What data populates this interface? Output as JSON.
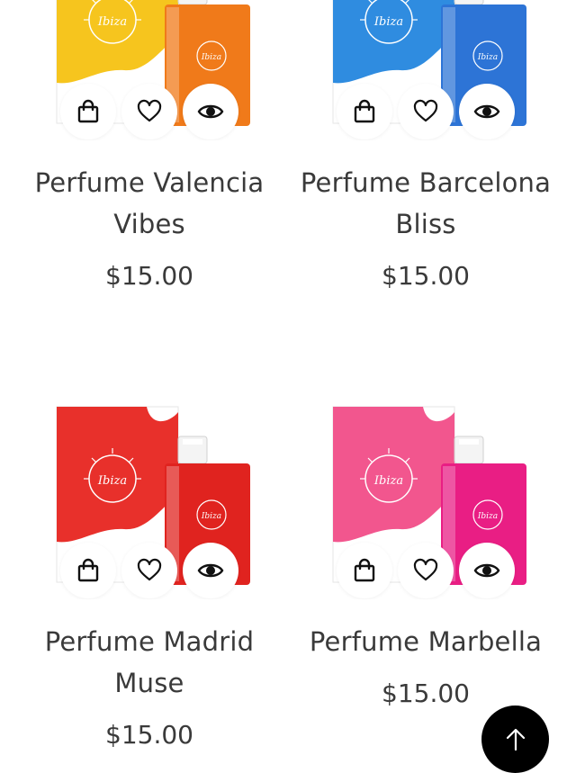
{
  "products": [
    {
      "name": "Perfume Valencia Vibes",
      "price": "$15.00",
      "box_color": "#f6c51e",
      "bottle_color": "#f07a1a",
      "brand_mark": "Ibiza",
      "cart_icon": "shopping-bag-icon",
      "wishlist_icon": "heart-icon",
      "quickview_icon": "eye-icon"
    },
    {
      "name": "Perfume Barcelona Bliss",
      "price": "$15.00",
      "box_color": "#2f8ce0",
      "bottle_color": "#2d74d6",
      "brand_mark": "Ibiza",
      "cart_icon": "shopping-bag-icon",
      "wishlist_icon": "heart-icon",
      "quickview_icon": "eye-icon"
    },
    {
      "name": "Perfume Madrid Muse",
      "price": "$15.00",
      "box_color": "#e8302b",
      "bottle_color": "#e0231f",
      "brand_mark": "Ibiza",
      "cart_icon": "shopping-bag-icon",
      "wishlist_icon": "heart-icon",
      "quickview_icon": "eye-icon"
    },
    {
      "name": "Perfume Marbella",
      "price": "$15.00",
      "box_color": "#f2568e",
      "bottle_color": "#e91e84",
      "brand_mark": "Ibiza",
      "cart_icon": "shopping-bag-icon",
      "wishlist_icon": "heart-icon",
      "quickview_icon": "eye-icon"
    }
  ],
  "back_to_top": {
    "icon": "arrow-up-icon",
    "background": "#000000"
  }
}
